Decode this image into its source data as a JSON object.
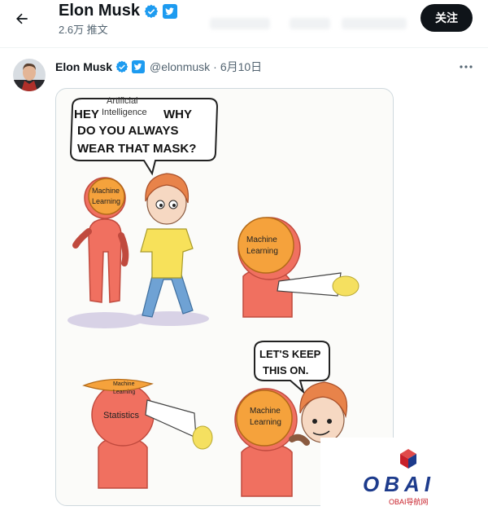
{
  "header": {
    "title": "Elon Musk",
    "post_count": "2.6万 推文",
    "follow_label": "关注"
  },
  "tweet": {
    "author_name": "Elon Musk",
    "handle": "@elonmusk",
    "separator": "·",
    "date": "6月10日"
  },
  "comic": {
    "speech1_line1": "HEY",
    "speech1_ai_1": "Artificial",
    "speech1_ai_2": "Intelligence",
    "speech1_why": "WHY",
    "speech1_line2": "DO YOU ALWAYS",
    "speech1_line3": "WEAR THAT MASK?",
    "mask_line1": "Machine",
    "mask_line2": "Learning",
    "statistics": "Statistics",
    "speech2_line1": "LET'S KEEP",
    "speech2_line2": "THIS ON."
  },
  "watermark": {
    "brand": "OBAI",
    "sub": "OBAI导航网"
  },
  "colors": {
    "verified_blue": "#1d9bf0",
    "follow_bg": "#0f1419",
    "robot_red": "#f07060",
    "mask_orange": "#f5a23c",
    "glove_yellow": "#f5e060",
    "watermark_red": "#c8202a",
    "watermark_navy": "#1d3b8c"
  },
  "icons": [
    "back-arrow-icon",
    "verified-badge-icon",
    "twitter-bird-icon",
    "more-options-icon"
  ]
}
